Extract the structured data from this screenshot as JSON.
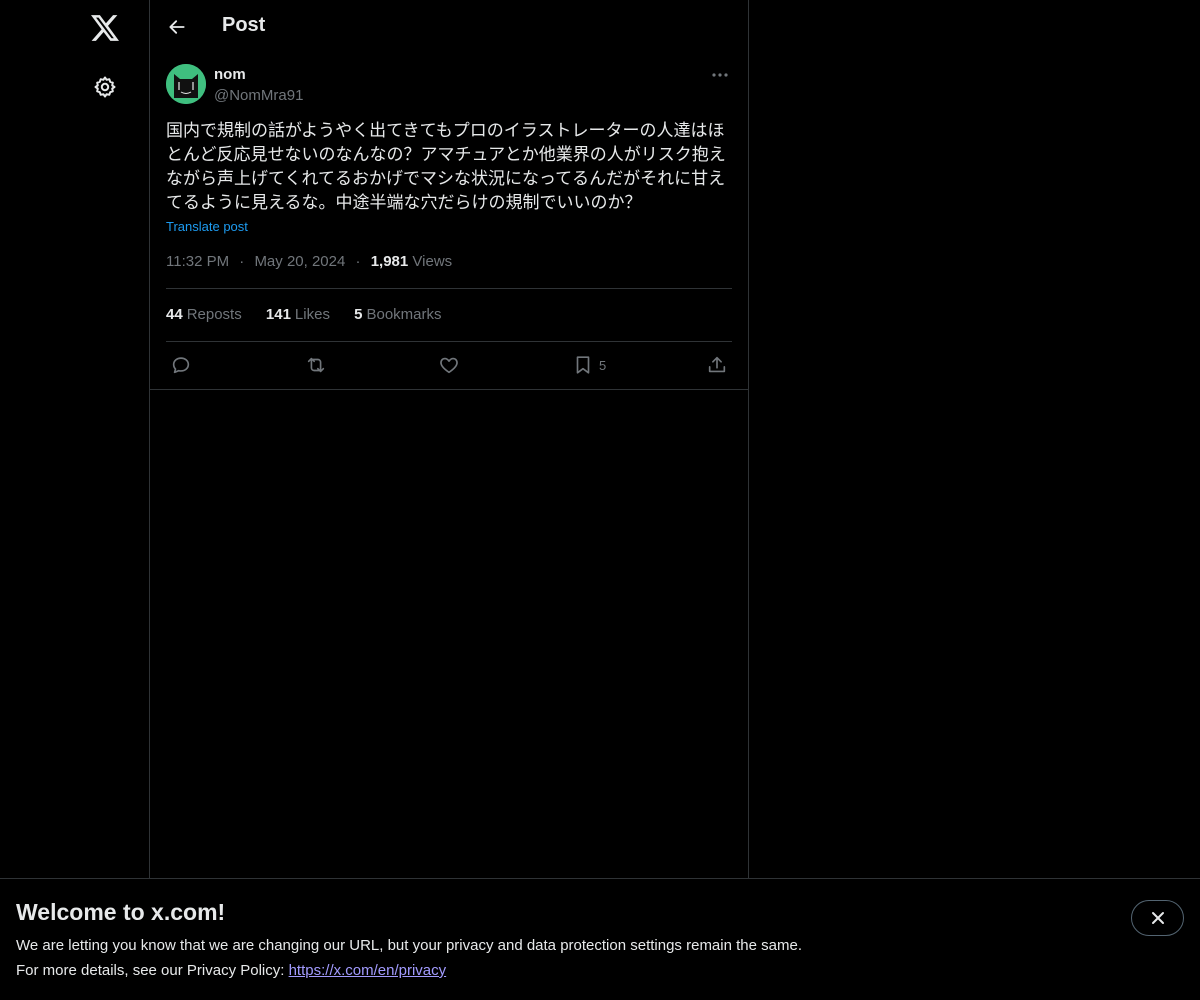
{
  "nav": {
    "logo_icon": "x-logo-icon",
    "settings_icon": "gear-icon"
  },
  "header": {
    "title": "Post",
    "back_icon": "arrow-left-icon"
  },
  "post": {
    "author_name": "nom",
    "author_handle": "@NomMra91",
    "text": "国内で規制の話がようやく出てきてもプロのイラストレーターの人達はほとんど反応見せないのなんなの？アマチュアとか他業界の人がリスク抱えながら声上げてくれてるおかげでマシな状況になってるんだがそれに甘えてるように見えるな。中途半端な穴だらけの規制でいいのか？",
    "translate_label": "Translate post",
    "time": "11:32 PM",
    "date": "May 20, 2024",
    "views_count": "1,981",
    "views_label": "Views",
    "separator": "·"
  },
  "stats": {
    "reposts_count": "44",
    "reposts_label": "Reposts",
    "likes_count": "141",
    "likes_label": "Likes",
    "bookmarks_count": "5",
    "bookmarks_label": "Bookmarks"
  },
  "actions": {
    "bookmark_count": "5"
  },
  "banner": {
    "title": "Welcome to x.com!",
    "line1": "We are letting you know that we are changing our URL, but your privacy and data protection settings remain the same.",
    "line2_prefix": "For more details, see our Privacy Policy: ",
    "link": "https://x.com/en/privacy"
  },
  "colors": {
    "background": "#000000",
    "text": "#e7e9ea",
    "secondary": "#71767b",
    "accent": "#1d9bf0",
    "avatar": "#3fbf7f"
  }
}
